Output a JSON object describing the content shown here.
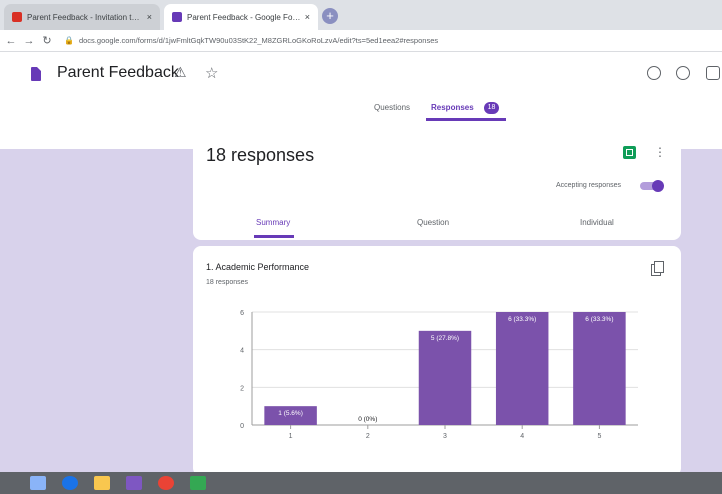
{
  "browser": {
    "tabs": [
      {
        "title": "Parent Feedback - Invitation to ...",
        "close": "×"
      },
      {
        "title": "Parent Feedback - Google Forms",
        "close": "×"
      }
    ],
    "new_tab": "+",
    "url": "docs.google.com/forms/d/1jwFmltGqkTW90u03StK22_M8ZGRLoGKoRoLzvA/edit?ts=5ed1eea2#responses"
  },
  "app": {
    "title": "Parent Feedback",
    "tabs": [
      {
        "label": "Questions"
      },
      {
        "label": "Responses",
        "badge": "18"
      }
    ]
  },
  "summary": {
    "title": "18 responses",
    "accepting_label": "Accepting responses",
    "accepting": true,
    "subtabs": [
      "Summary",
      "Question",
      "Individual"
    ]
  },
  "question": {
    "title": "1. Academic Performance",
    "count": "18 responses"
  },
  "colors": {
    "accent": "#673ab7",
    "bar": "#7b52ab",
    "background": "#d8d2eb"
  },
  "chart_data": {
    "type": "bar",
    "categories": [
      "1",
      "2",
      "3",
      "4",
      "5"
    ],
    "values": [
      1,
      0,
      5,
      6,
      6
    ],
    "data_labels": [
      "1 (5.6%)",
      "0 (0%)",
      "5 (27.8%)",
      "6 (33.3%)",
      "6 (33.3%)"
    ],
    "yticks": [
      "0",
      "2",
      "4",
      "6"
    ],
    "ylim": [
      0,
      6
    ],
    "grid": true
  }
}
